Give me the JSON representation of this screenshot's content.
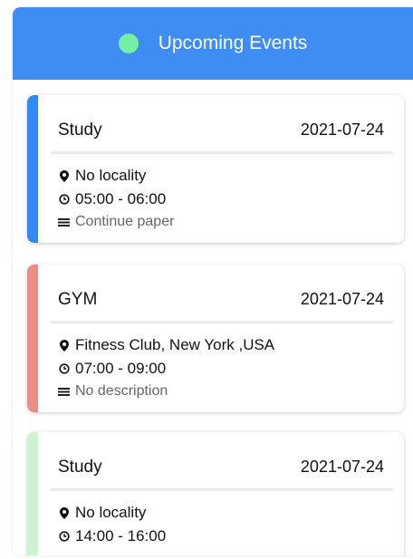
{
  "header": {
    "title": "Upcoming Events",
    "dot_color": "#74f0a6",
    "bg_color": "#3f8cf3"
  },
  "events": [
    {
      "title": "Study",
      "date": "2021-07-24",
      "location": "No locality",
      "time": "05:00 - 06:00",
      "description": "Continue paper",
      "color": "#2f8af5"
    },
    {
      "title": "GYM",
      "date": "2021-07-24",
      "location": "Fitness Club, New York ,USA",
      "time": "07:00 - 09:00",
      "description": "No description",
      "color": "#ec8c86"
    },
    {
      "title": "Study",
      "date": "2021-07-24",
      "location": "No locality",
      "time": "14:00 - 16:00",
      "description": "",
      "color": "#cdf2d0"
    }
  ]
}
